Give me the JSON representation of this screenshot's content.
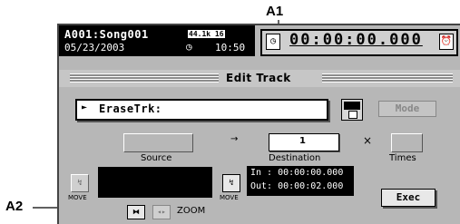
{
  "callouts": {
    "a1": "A1",
    "a2": "A2"
  },
  "status": {
    "song": "A001:Song001",
    "bit_badge": "44.1k 16",
    "date": "05/23/2003",
    "clock_icon": "clock-icon",
    "time": "10:50",
    "counter": "00:00:00.000"
  },
  "panel": {
    "title": "Edit Track",
    "function": "EraseTrk:",
    "mode_label": "Mode",
    "source_label": "Source",
    "arrow": "→",
    "destination_label": "Destination",
    "destination_value": "1",
    "times_symbol": "×",
    "times_label": "Times",
    "in_time": "In : 00:00:00.000",
    "out_time": "Out: 00:00:02.000",
    "exec_label": "Exec",
    "move_left": "MOVE",
    "move_right": "MOVE",
    "zoom_label": "ZOOM"
  }
}
